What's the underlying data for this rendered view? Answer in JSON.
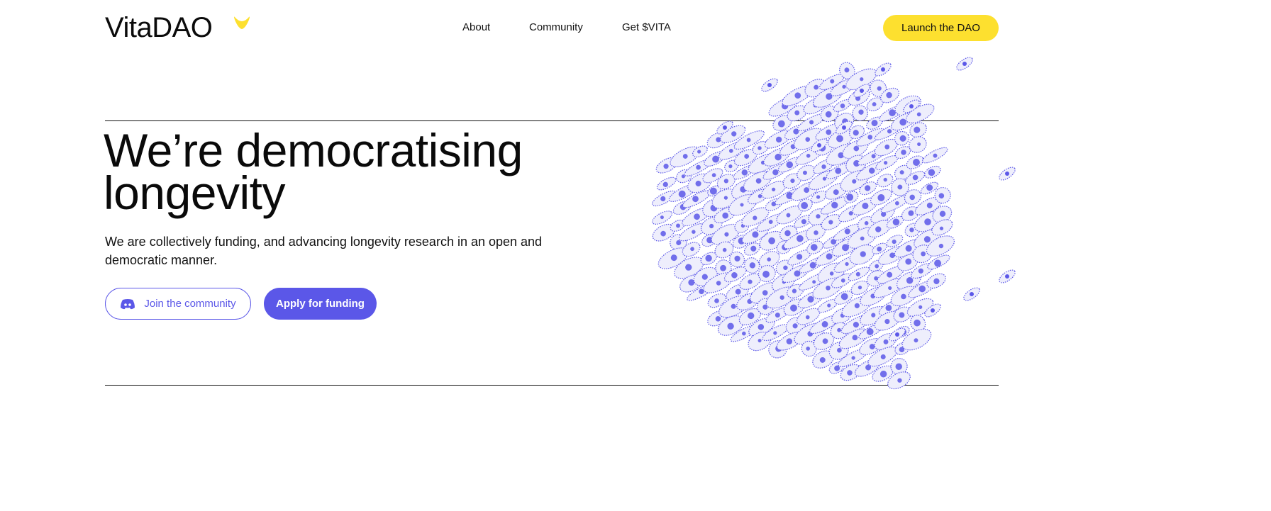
{
  "header": {
    "logo_text": "VitaDAO",
    "nav": [
      {
        "label": "About"
      },
      {
        "label": "Community"
      },
      {
        "label": "Get $VITA"
      }
    ],
    "cta_label": "Launch the DAO"
  },
  "hero": {
    "headline": "We’re democratising longevity",
    "subtitle": "We are collectively funding, and advancing longevity research in an open and democratic manner.",
    "join_label": "Join the community",
    "apply_label": "Apply for funding"
  },
  "icons": {
    "logo_mark": "heart-mark",
    "join_icon": "discord-icon"
  },
  "colors": {
    "accent_purple": "#5b57e8",
    "accent_yellow": "#fde02f",
    "text": "#0b0b0b",
    "background": "#ffffff"
  }
}
